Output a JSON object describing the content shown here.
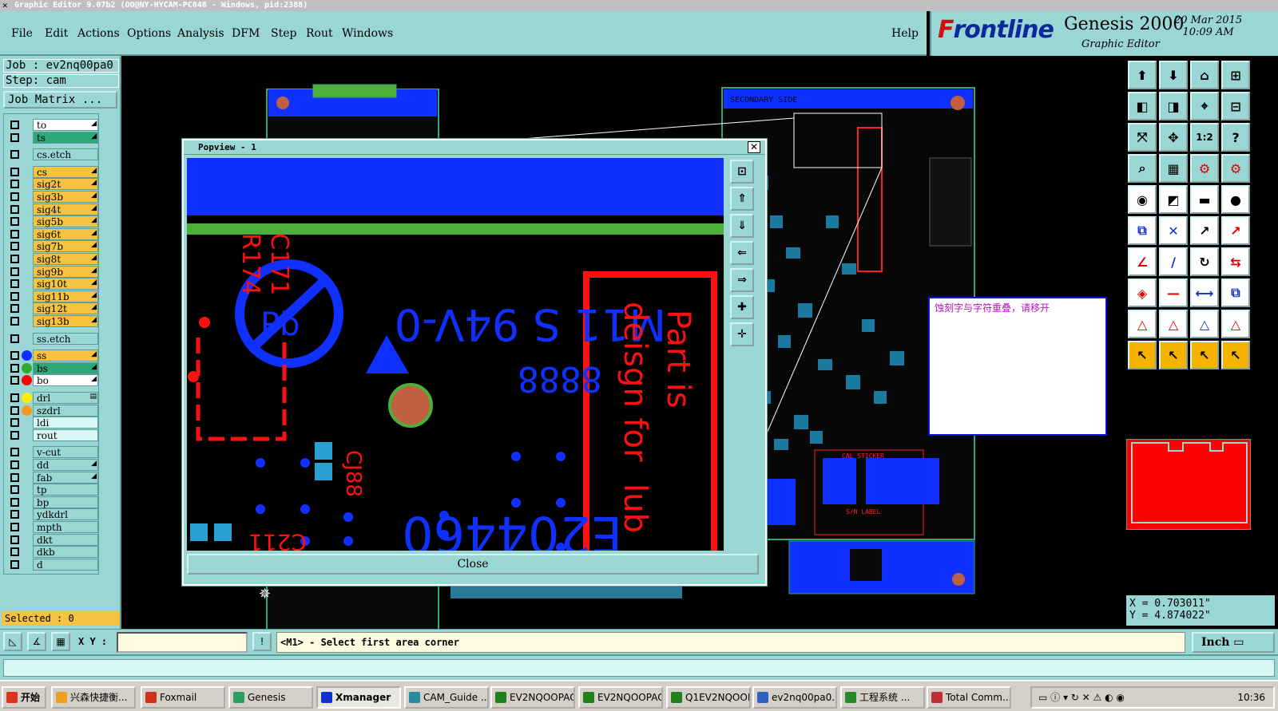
{
  "window": {
    "title": "Graphic Editor 9.07b2  (OO@NY-HYCAM-PC048 - Windows, pid:2388)"
  },
  "menu": {
    "items": [
      "File",
      "Edit",
      "Actions",
      "Options",
      "Analysis",
      "DFM",
      "Step",
      "Rout",
      "Windows"
    ],
    "help": "Help"
  },
  "brand": {
    "logo_prefix": "F",
    "logo_rest": "rontline",
    "product": "Genesis 2000",
    "subtitle": "Graphic Editor",
    "date": "20 Mar 2015",
    "time": "10:09 AM"
  },
  "job": {
    "job_label": "Job : ev2nq00pa0",
    "step_label": "Step: cam",
    "matrix_button": "Job Matrix ..."
  },
  "layers": [
    {
      "name": "to",
      "color": "#ffffff",
      "dot": "",
      "arrow": "◢"
    },
    {
      "name": "ts",
      "color": "#2ea87a",
      "dot": "",
      "arrow": "◢"
    },
    {
      "name": "cs.etch",
      "color": "#9ad6d4",
      "dot": "",
      "arrow": ""
    },
    {
      "name": "cs",
      "color": "#f5c242",
      "dot": "",
      "arrow": "◢"
    },
    {
      "name": "sig2t",
      "color": "#f5c242",
      "dot": "",
      "arrow": "◢"
    },
    {
      "name": "sig3b",
      "color": "#f5c242",
      "dot": "",
      "arrow": "◢"
    },
    {
      "name": "sig4t",
      "color": "#f5c242",
      "dot": "",
      "arrow": "◢"
    },
    {
      "name": "sig5b",
      "color": "#f5c242",
      "dot": "",
      "arrow": "◢"
    },
    {
      "name": "sig6t",
      "color": "#f5c242",
      "dot": "",
      "arrow": "◢"
    },
    {
      "name": "sig7b",
      "color": "#f5c242",
      "dot": "",
      "arrow": "◢"
    },
    {
      "name": "sig8t",
      "color": "#f5c242",
      "dot": "",
      "arrow": "◢"
    },
    {
      "name": "sig9b",
      "color": "#f5c242",
      "dot": "",
      "arrow": "◢"
    },
    {
      "name": "sig10t",
      "color": "#f5c242",
      "dot": "",
      "arrow": "◢"
    },
    {
      "name": "sig11b",
      "color": "#f5c242",
      "dot": "",
      "arrow": "◢"
    },
    {
      "name": "sig12t",
      "color": "#f5c242",
      "dot": "",
      "arrow": "◢"
    },
    {
      "name": "sig13b",
      "color": "#f5c242",
      "dot": "",
      "arrow": "◢"
    },
    {
      "name": "ss.etch",
      "color": "#9ad6d4",
      "dot": "",
      "arrow": ""
    },
    {
      "name": "ss",
      "color": "#f5c242",
      "dot": "#1030ff",
      "arrow": "◢"
    },
    {
      "name": "bs",
      "color": "#2ea87a",
      "dot": "#2ea82e",
      "arrow": "◢"
    },
    {
      "name": "bo",
      "color": "#ffffff",
      "dot": "#ff0000",
      "arrow": "◢"
    },
    {
      "name": "drl",
      "color": "#9ad6d4",
      "dot": "#ffee00",
      "arrow": "▤"
    },
    {
      "name": "szdrl",
      "color": "#9ad6d4",
      "dot": "#f59a20",
      "arrow": ""
    },
    {
      "name": "ldi",
      "color": "#d8f8f6",
      "dot": "",
      "arrow": ""
    },
    {
      "name": "rout",
      "color": "#d8f8f6",
      "dot": "",
      "arrow": ""
    },
    {
      "name": "v-cut",
      "color": "#9ad6d4",
      "dot": "",
      "arrow": ""
    },
    {
      "name": "dd",
      "color": "#9ad6d4",
      "dot": "",
      "arrow": "◢"
    },
    {
      "name": "fab",
      "color": "#9ad6d4",
      "dot": "",
      "arrow": "◢"
    },
    {
      "name": "tp",
      "color": "#9ad6d4",
      "dot": "",
      "arrow": ""
    },
    {
      "name": "bp",
      "color": "#9ad6d4",
      "dot": "",
      "arrow": ""
    },
    {
      "name": "ydkdrl",
      "color": "#9ad6d4",
      "dot": "",
      "arrow": ""
    },
    {
      "name": "mpth",
      "color": "#9ad6d4",
      "dot": "",
      "arrow": ""
    },
    {
      "name": "dkt",
      "color": "#9ad6d4",
      "dot": "",
      "arrow": ""
    },
    {
      "name": "dkb",
      "color": "#9ad6d4",
      "dot": "",
      "arrow": ""
    },
    {
      "name": "d",
      "color": "#9ad6d4",
      "dot": "",
      "arrow": ""
    }
  ],
  "selected": "Selected : 0",
  "popview": {
    "title": "Popview - 1",
    "close_button": "Close",
    "silkscreen": {
      "code": "E204460",
      "grade": "M11 S 94V-0",
      "date": "8888",
      "refs": [
        "R174",
        "C171",
        "CJ88",
        "C211"
      ],
      "side_text": [
        "Pb",
        "Part is",
        "deisgn for",
        "lub"
      ]
    }
  },
  "board": {
    "label_top": "SECONDARY SIDE",
    "label_sticker": "CAL STICKER",
    "label_bottom": "S/N LABEL"
  },
  "note": {
    "text": "蚀刻字与字符重叠，请移开"
  },
  "coords": {
    "x": "X = 0.703011\"",
    "y": "Y = 4.874022\""
  },
  "command": {
    "xy_label": "X Y :",
    "xy_value": "",
    "prompt": "<M1> - Select first area corner",
    "unit": "Inch ▭"
  },
  "toolbar": {
    "icons": [
      "open-icon",
      "save-icon",
      "home-icon",
      "zoom-fit-icon",
      "zoom-prev-icon",
      "zoom-next-icon",
      "pan-icon",
      "snap-icon",
      "fit-screen-icon",
      "center-icon",
      "scale-1-2-icon",
      "help-icon",
      "measure-icon",
      "grid-icon",
      "graphic-red-icon",
      "graphic-blue-icon",
      "add-pad-icon",
      "pointer-line-icon",
      "ruler-icon",
      "dot-icon",
      "connect-icon",
      "cross-icon",
      "link-icon",
      "link-red-icon",
      "angle-red-icon",
      "angle-blue-icon",
      "rotate-icon",
      "mirror-icon",
      "feature-icon",
      "line-icon",
      "width-icon",
      "copy-icon",
      "triangle-red-icon",
      "triangle-blue-icon",
      "triangle-frame-icon",
      "triangle-select-icon",
      "select-icon",
      "select-box-icon",
      "select-drag-icon",
      "select-edit-icon"
    ]
  },
  "taskbar": {
    "start": "开始",
    "tasks": [
      "兴森快捷衡...",
      "Foxmail",
      "Genesis",
      "Xmanager",
      "CAM_Guide ...",
      "EV2NQOOPAO...",
      "EV2NQOOPAO...",
      "Q1EV2NQOOP...",
      "ev2nq00pa0...",
      "工程系统 ...",
      "Total Comm..."
    ],
    "clock": "10:36"
  }
}
